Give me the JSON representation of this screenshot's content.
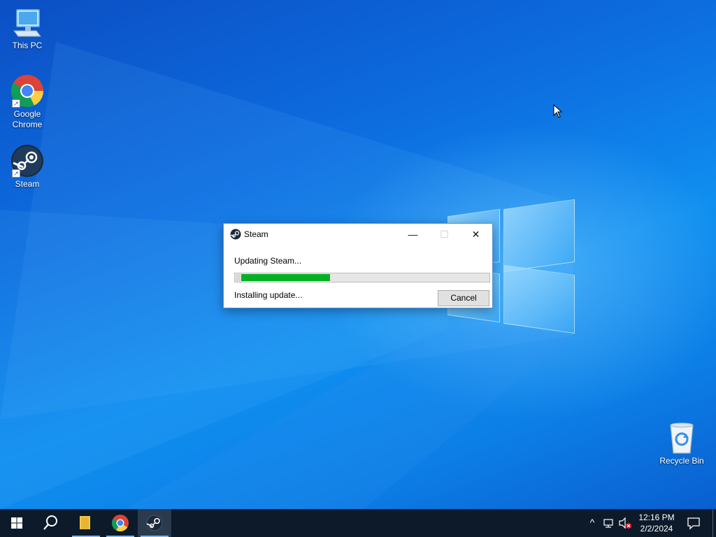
{
  "desktop": {
    "icons": [
      {
        "label": "This PC",
        "icon": "this-pc-icon"
      },
      {
        "label": "Google\nChrome",
        "label_line1": "Google",
        "label_line2": "Chrome",
        "icon": "chrome-icon"
      },
      {
        "label": "Steam",
        "icon": "steam-icon"
      },
      {
        "label": "Recycle Bin",
        "icon": "recycle-bin-icon"
      }
    ]
  },
  "dialog": {
    "title": "Steam",
    "heading": "Updating Steam...",
    "status": "Installing update...",
    "progress_fraction": 0.36,
    "cancel_label": "Cancel",
    "minimize_symbol": "—",
    "maximize_symbol": "☐",
    "close_symbol": "✕"
  },
  "taskbar": {
    "items": [
      {
        "icon": "windows-start-icon"
      },
      {
        "icon": "search-icon"
      },
      {
        "icon": "file-explorer-icon"
      },
      {
        "icon": "chrome-icon"
      },
      {
        "icon": "steam-icon"
      }
    ],
    "tray": {
      "chevron": "^",
      "time": "12:16 PM",
      "date": "2/2/2024"
    }
  },
  "colors": {
    "progress": "#06b025",
    "taskbar": "#0c1a2a",
    "accent": "#0078d7"
  }
}
